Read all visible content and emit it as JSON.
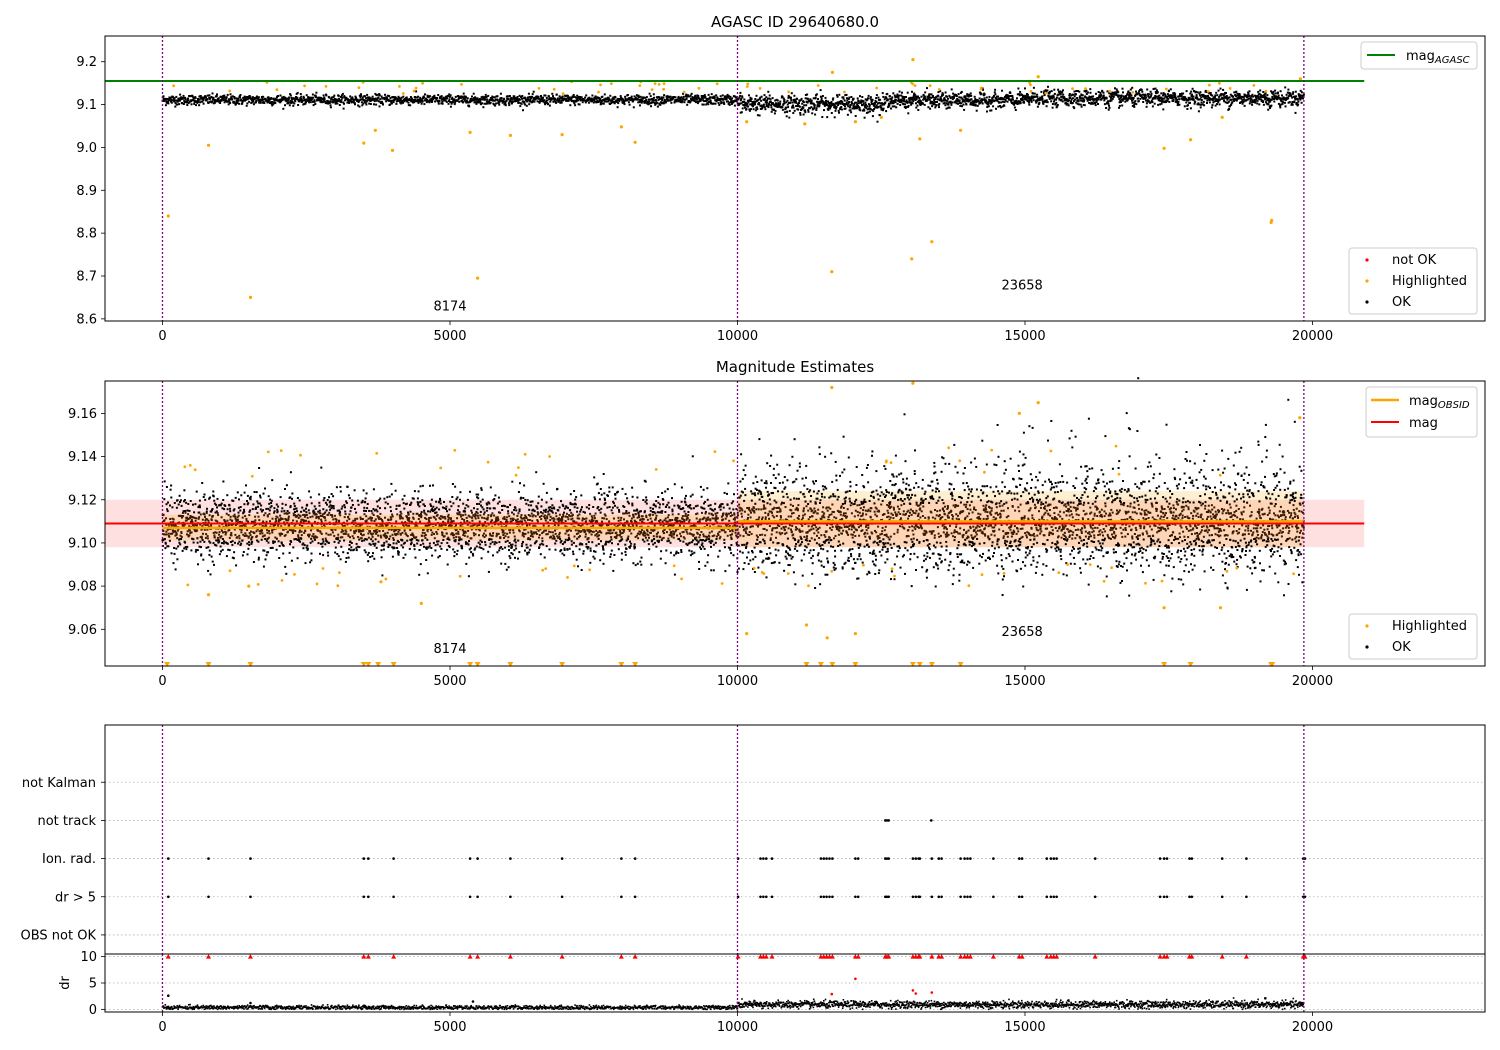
{
  "chart_data": [
    {
      "type": "scatter",
      "title": "AGASC ID 29640680.0",
      "xlabel": "",
      "ylabel": "",
      "xlim": [
        -1000,
        23000
      ],
      "ylim": [
        8.595,
        9.26
      ],
      "x_ticks": [
        0,
        5000,
        10000,
        15000,
        20000
      ],
      "y_ticks": [
        8.6,
        8.7,
        8.8,
        8.9,
        9.0,
        9.1,
        9.2
      ],
      "obsid_boundaries": [
        0,
        10000,
        19850
      ],
      "segment_labels": [
        {
          "text": "8174",
          "x": 5000,
          "y": 8.62
        },
        {
          "text": "23658",
          "x": 14950,
          "y": 8.668
        }
      ],
      "reference_lines": [
        {
          "name": "mag_AGASC",
          "legend_label": "mag",
          "legend_subscript": "AGASC",
          "y": 9.155,
          "x_range": [
            -1000,
            20900
          ],
          "color": "#008000"
        }
      ],
      "series": [
        {
          "name": "not OK",
          "color": "#ff0000",
          "points": []
        },
        {
          "name": "Highlighted",
          "color": "#ffa500",
          "points": [
            [
              100,
              8.84
            ],
            [
              800,
              9.005
            ],
            [
              1530,
              8.65
            ],
            [
              3500,
              9.01
            ],
            [
              3700,
              9.04
            ],
            [
              4000,
              8.993
            ],
            [
              5350,
              9.035
            ],
            [
              5480,
              8.695
            ],
            [
              6050,
              9.028
            ],
            [
              6950,
              9.03
            ],
            [
              7980,
              9.048
            ],
            [
              8220,
              9.012
            ],
            [
              10160,
              9.06
            ],
            [
              11170,
              9.055
            ],
            [
              11640,
              8.71
            ],
            [
              11650,
              9.175
            ],
            [
              12050,
              9.06
            ],
            [
              13050,
              9.205
            ],
            [
              13030,
              8.74
            ],
            [
              13170,
              9.02
            ],
            [
              13380,
              8.78
            ],
            [
              13880,
              9.04
            ],
            [
              15230,
              9.165
            ],
            [
              17420,
              8.998
            ],
            [
              17880,
              9.018
            ],
            [
              19280,
              8.825
            ],
            [
              19290,
              8.83
            ],
            [
              19790,
              9.16
            ],
            [
              18430,
              9.07
            ],
            [
              12500,
              9.07
            ]
          ]
        },
        {
          "name": "OK",
          "color": "#000000",
          "points": []
        }
      ],
      "legends": [
        {
          "position": "top-right",
          "entries": [
            "mag_AGASC"
          ]
        },
        {
          "position": "lower-right",
          "entries": [
            "not OK",
            "Highlighted",
            "OK"
          ]
        }
      ]
    },
    {
      "type": "scatter",
      "title": "Magnitude Estimates",
      "xlabel": "",
      "ylabel": "",
      "xlim": [
        -1000,
        23000
      ],
      "ylim": [
        9.043,
        9.175
      ],
      "x_ticks": [
        0,
        5000,
        10000,
        15000,
        20000
      ],
      "y_ticks": [
        9.06,
        9.08,
        9.1,
        9.12,
        9.14,
        9.16
      ],
      "obsid_boundaries": [
        0,
        10000,
        19850
      ],
      "segment_labels": [
        {
          "text": "8174",
          "x": 5000,
          "y": 9.049
        },
        {
          "text": "23658",
          "x": 14950,
          "y": 9.057
        }
      ],
      "reference_lines": [
        {
          "name": "mag",
          "y": 9.109,
          "band": [
            9.098,
            9.12
          ],
          "x_range": [
            -1000,
            20900
          ],
          "color": "#ff0000"
        },
        {
          "name": "mag_OBSID",
          "legend_label": "mag",
          "legend_subscript": "OBSID",
          "segments": [
            {
              "x": [
                0,
                10000
              ],
              "y": 9.107,
              "band": [
                9.101,
                9.113
              ]
            },
            {
              "x": [
                10000,
                19850
              ],
              "y": 9.11,
              "band": [
                9.098,
                9.124
              ]
            }
          ],
          "color": "#ffa500"
        }
      ],
      "series": [
        {
          "name": "Highlighted",
          "color": "#ffa500",
          "points": [
            [
              10160,
              9.058
            ],
            [
              11200,
              9.062
            ],
            [
              11640,
              9.172
            ],
            [
              11560,
              9.056
            ],
            [
              13050,
              9.174
            ],
            [
              12050,
              9.058
            ],
            [
              15230,
              9.165
            ],
            [
              14900,
              9.16
            ],
            [
              17420,
              9.07
            ],
            [
              18400,
              9.07
            ],
            [
              19780,
              9.158
            ],
            [
              3800,
              9.082
            ],
            [
              4500,
              9.072
            ],
            [
              800,
              9.076
            ],
            [
              1500,
              9.08
            ]
          ]
        },
        {
          "name": "OK",
          "color": "#000000",
          "points": []
        }
      ],
      "offscale_markers": {
        "color": "#ffa500",
        "y": 9.043,
        "x": [
          80,
          800,
          1530,
          3500,
          3580,
          3750,
          4020,
          5350,
          5480,
          6050,
          6950,
          7980,
          8220,
          11200,
          11450,
          11650,
          12050,
          13050,
          13170,
          13380,
          13880,
          17420,
          17880,
          19280,
          19300
        ]
      },
      "legends": [
        {
          "position": "top-right",
          "entries": [
            "mag_OBSID",
            "mag"
          ]
        },
        {
          "position": "lower-right",
          "entries": [
            "Highlighted",
            "OK"
          ]
        }
      ]
    },
    {
      "type": "scatter",
      "title": "",
      "xlabel": "",
      "ylabel": "",
      "xlim": [
        -1000,
        23000
      ],
      "ylim": [
        -0.5,
        5.5
      ],
      "categories": [
        "OBS not OK",
        "dr > 5",
        "Ion. rad.",
        "not track",
        "not Kalman"
      ],
      "grid": true,
      "obsid_boundaries": [
        0,
        10000,
        19850
      ],
      "flag_events": {
        "not track": [
          12570,
          12600,
          12630,
          13370
        ],
        "Ion. rad.": [
          100,
          800,
          1530,
          3500,
          3580,
          4020,
          5350,
          5480,
          6050,
          6950,
          7980,
          8220,
          10010,
          10400,
          10450,
          10500,
          10600,
          11450,
          11500,
          11550,
          11600,
          11650,
          12050,
          12100,
          12570,
          12600,
          12630,
          13050,
          13100,
          13150,
          13170,
          13380,
          13500,
          13550,
          13880,
          13950,
          14000,
          14050,
          14450,
          14900,
          14950,
          15380,
          15450,
          15500,
          15550,
          16220,
          17350,
          17420,
          17470,
          17860,
          17900,
          18430,
          18850,
          19840,
          19870
        ],
        "dr > 5": [
          100,
          800,
          1530,
          3500,
          3580,
          4020,
          5350,
          5480,
          6050,
          6950,
          7980,
          8220,
          10010,
          10400,
          10450,
          10500,
          10600,
          11450,
          11500,
          11550,
          11600,
          11650,
          12050,
          12100,
          12570,
          12600,
          12630,
          13050,
          13100,
          13150,
          13170,
          13380,
          13500,
          13550,
          13880,
          13950,
          14000,
          14050,
          14450,
          14900,
          14950,
          15380,
          15450,
          15500,
          15550,
          16220,
          17350,
          17420,
          17470,
          17860,
          17900,
          18430,
          18850,
          19840,
          19870
        ]
      }
    },
    {
      "type": "scatter",
      "title": "",
      "xlabel": "",
      "ylabel": "dr",
      "xlim": [
        -1000,
        23000
      ],
      "ylim": [
        -0.5,
        10.5
      ],
      "x_ticks": [
        0,
        5000,
        10000,
        15000,
        20000
      ],
      "y_ticks": [
        0,
        5,
        10
      ],
      "grid": true,
      "obsid_boundaries": [
        0,
        10000,
        19850
      ],
      "clipped_value": 10,
      "clipped_x": [
        100,
        800,
        1530,
        3500,
        3580,
        4020,
        5350,
        5480,
        6050,
        6950,
        7980,
        8220,
        10010,
        10400,
        10450,
        10500,
        10600,
        11450,
        11500,
        11550,
        11600,
        11650,
        12050,
        12100,
        12570,
        12600,
        12630,
        13050,
        13100,
        13150,
        13170,
        13380,
        13500,
        13550,
        13880,
        13950,
        14000,
        14050,
        14450,
        14900,
        14950,
        15380,
        15450,
        15500,
        15550,
        16220,
        17350,
        17420,
        17470,
        17860,
        17900,
        18430,
        18850,
        19840,
        19870
      ],
      "clipped_color": "#ff0000",
      "red_points": [
        [
          12050,
          5.8
        ],
        [
          13050,
          3.6
        ],
        [
          13100,
          3.0
        ],
        [
          11640,
          2.9
        ],
        [
          13380,
          3.2
        ]
      ],
      "black_points": [
        [
          100,
          2.6
        ],
        [
          5400,
          1.5
        ],
        [
          1530,
          1.2
        ],
        [
          19180,
          2.1
        ]
      ],
      "black_level": {
        "x_range": [
          0,
          10000
        ],
        "mean": 0.35
      },
      "black_level_2": {
        "x_range": [
          10000,
          19850
        ],
        "mean": 0.9
      }
    }
  ]
}
